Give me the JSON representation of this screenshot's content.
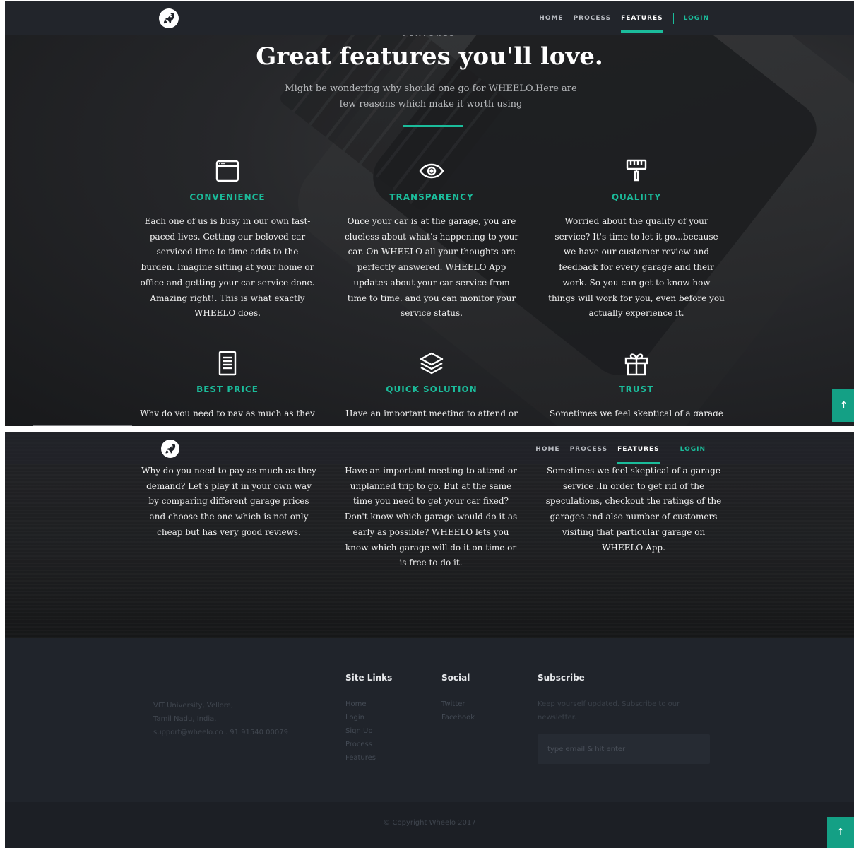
{
  "nav": {
    "items": [
      "HOME",
      "PROCESS",
      "FEATURES"
    ],
    "active": "FEATURES",
    "login": "LOGIN"
  },
  "section": {
    "eyebrow": "FEATURES",
    "title": "Great features you'll love.",
    "subtitle": "Might be wondering why should one go for WHEELO.Here are few reasons which make it worth using"
  },
  "features": [
    {
      "icon": "browser-window-icon",
      "title": "CONVENIENCE",
      "text": "Each one of us is busy in our own fast-paced lives. Getting our beloved car serviced time to time adds to the burden. Imagine sitting at your home or office and getting your car-service done. Amazing right!. This is what exactly WHEELO does."
    },
    {
      "icon": "eye-icon",
      "title": "TRANSPARENCY",
      "text": "Once your car is at the garage, you are clueless about what’s happening to your car. On WHEELO all your thoughts are perfectly answered. WHEELO App updates about your car service from time to time. and you can monitor your service status."
    },
    {
      "icon": "paint-roller-icon",
      "title": "QUALIITY",
      "text": "Worried about the quality of your service? It's time to let it go...because we have our customer review and feedback for every garage and their work. So you can get to know how things will work for you, even before you actually experience it."
    },
    {
      "icon": "document-icon",
      "title": "BEST PRICE",
      "text": "Why do you need to pay as much as they demand? Let's play it in your own way by comparing different garage prices and choose the one which is not only cheap but has very good reviews."
    },
    {
      "icon": "layers-icon",
      "title": "QUICK SOLUTION",
      "text": "Have an important meeting to attend or unplanned trip to go. But at the same time you need to get your car fixed? Don't know which garage would do it as early as possible? WHEELO lets you know which garage will do it on time or is free to do it."
    },
    {
      "icon": "gift-icon",
      "title": "TRUST",
      "text": "Sometimes we feel skeptical of a garage service .In order to get rid of the speculations, checkout the ratings of the garages and also number of customers visiting that particular garage on WHEELO App."
    }
  ],
  "panel1_peek": [
    "Why do you need to pay as much as they",
    "Have an important meeting to attend or",
    "Sometimes we feel skeptical of a garage"
  ],
  "footer": {
    "address": [
      "VIT University, Vellore,",
      "Tamil Nadu, India.",
      "support@wheelo.co . 91 91540 00079"
    ],
    "site_links": {
      "heading": "Site Links",
      "items": [
        "Home",
        "Login",
        "Sign Up",
        "Process",
        "Features"
      ]
    },
    "social": {
      "heading": "Social",
      "items": [
        "Twitter",
        "Facebook"
      ]
    },
    "subscribe": {
      "heading": "Subscribe",
      "text": "Keep yourself updated. Subscribe to our newsletter.",
      "placeholder": "type email & hit enter"
    },
    "copyright": "© Copyright Wheelo 2017"
  },
  "colors": {
    "accent": "#1bbc9b",
    "navbar": "#22252b",
    "footer": "#20242b"
  },
  "icons": {
    "scroll_top": "arrow-up-icon",
    "logo": "rocket-icon"
  }
}
